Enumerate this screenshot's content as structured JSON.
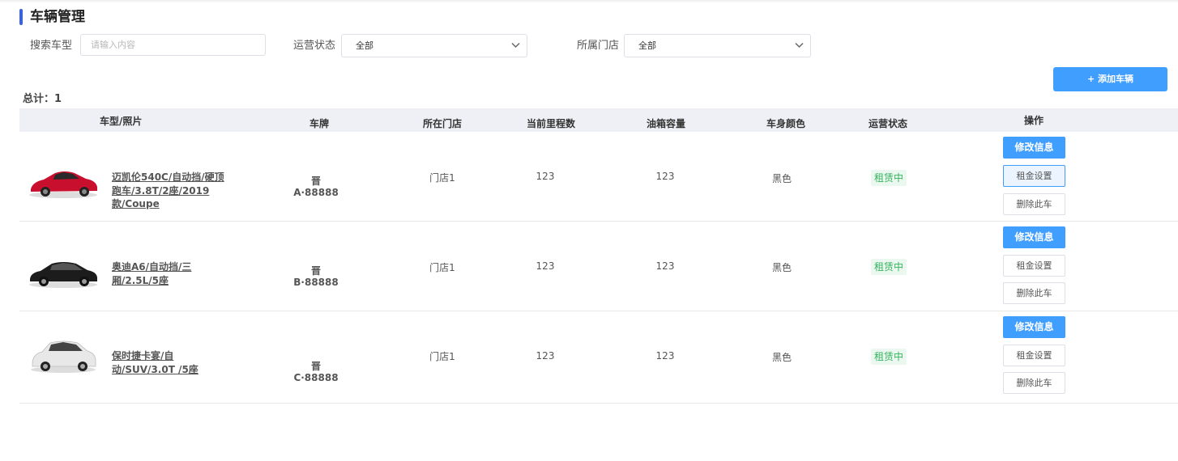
{
  "page": {
    "title": "车辆管理"
  },
  "filters": {
    "search": {
      "label": "搜索车型",
      "placeholder": "请输入内容",
      "value": ""
    },
    "status": {
      "label": "运营状态",
      "value": "全部"
    },
    "store": {
      "label": "所属门店",
      "value": "全部"
    }
  },
  "toolbar": {
    "add_label": "+ 添加车辆"
  },
  "total_label": "总计：1",
  "table": {
    "headers": [
      "车型/照片",
      "车牌",
      "所在门店",
      "当前里程数",
      "油箱容量",
      "车身颜色",
      "运营状态",
      "操作"
    ],
    "rows": [
      {
        "model": "迈凯伦540C/自动挡/硬顶跑车/3.8T/2座/2019款/Coupe",
        "plate": "晋A·88888",
        "store": "门店1",
        "mileage": "123",
        "tank": "123",
        "color": "黑色",
        "status": "租赁中",
        "photo_color": "#c8102e"
      },
      {
        "model": "奥迪A6/自动挡/三厢/2.5L/5座",
        "plate": "晋B·88888",
        "store": "门店1",
        "mileage": "123",
        "tank": "123",
        "color": "黑色",
        "status": "租赁中",
        "photo_color": "#1c1c1c"
      },
      {
        "model": "保时捷卡宴/自动/SUV/3.0T /5座",
        "plate": "晋C·88888",
        "store": "门店1",
        "mileage": "123",
        "tank": "123",
        "color": "黑色",
        "status": "租赁中",
        "photo_color": "#e8e8e8"
      }
    ]
  },
  "actions": {
    "edit": "修改信息",
    "rent": "租金设置",
    "delete": "删除此车"
  },
  "colors": {
    "accent": "#3b62d6",
    "primary": "#409eff",
    "status_green": "#37b35f",
    "header_bg": "#eef0f6"
  }
}
